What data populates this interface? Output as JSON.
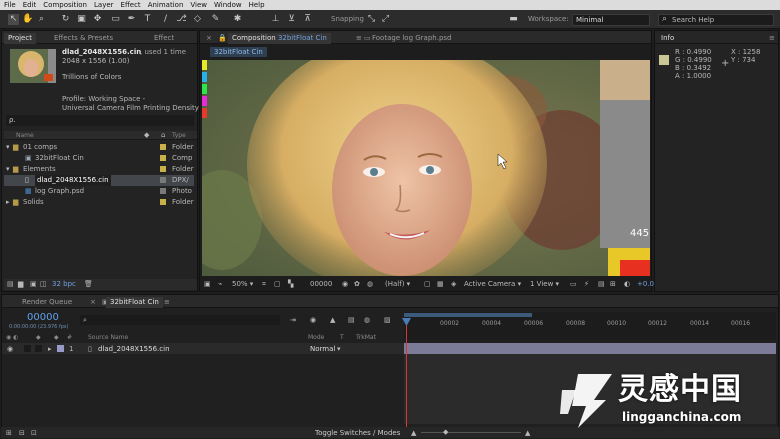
{
  "menu": [
    "File",
    "Edit",
    "Composition",
    "Layer",
    "Effect",
    "Animation",
    "View",
    "Window",
    "Help"
  ],
  "toolbar": {
    "snapping_label": "Snapping",
    "workspace_label": "Workspace:",
    "workspace_value": "Minimal",
    "search_placeholder": "Search Help"
  },
  "project": {
    "tabs": [
      "Project",
      "Effects & Presets",
      "Effect"
    ],
    "file_name": "dlad_2048X1556.cin",
    "used": ", used 1 time",
    "dimensions": "2048 x 1556 (1.00)",
    "colors": "Trillions of Colors",
    "profile_line1": "Profile: Working Space -",
    "profile_line2": "Universal Camera Film Printing Density (...",
    "search_icon_label": "ρ.",
    "col_name": "Name",
    "col_type": "Type",
    "items": [
      {
        "name": "01 comps",
        "type": "Folder",
        "color": "#c9b04a",
        "level": 0,
        "kind": "folder"
      },
      {
        "name": "32bitFloat Cin",
        "type": "Comp",
        "color": "#c9b04a",
        "level": 1,
        "kind": "comp"
      },
      {
        "name": "Elements",
        "type": "Folder",
        "color": "#c9b04a",
        "level": 0,
        "kind": "folder"
      },
      {
        "name": "dlad_2048X1556.cin",
        "type": "DPX/",
        "color": "#7a7a7a",
        "level": 1,
        "kind": "file"
      },
      {
        "name": "log Graph.psd",
        "type": "Photo",
        "color": "#7a7a7a",
        "level": 1,
        "kind": "psd"
      },
      {
        "name": "Solids",
        "type": "Folder",
        "color": "#c9b04a",
        "level": 0,
        "kind": "folder"
      }
    ],
    "bpc": "32 bpc"
  },
  "composition": {
    "tabs": [
      "Composition 32bitFloat Cin",
      "Footage log Graph.psd"
    ],
    "comp_tab_prefix": "Composition",
    "comp_tab_name": "32bitFloat Cin",
    "sub_tab": "32bitFloat Cin",
    "overlay_number": "445",
    "zoom": "50%",
    "timecode": "00000",
    "resolution": "(Half)",
    "camera": "Active Camera",
    "view": "1 View",
    "exposure": "+0.0"
  },
  "info": {
    "title": "Info",
    "r": "R : 0.4990",
    "g": "G : 0.4990",
    "b": "B : 0.3492",
    "a": "A : 1.0000",
    "x": "X : 1258",
    "y": "Y : 734",
    "swatch_color": "#c9c597"
  },
  "timeline": {
    "tabs": [
      "Render Queue",
      "32bitFloat Cin"
    ],
    "timecode": "00000",
    "timecode_sub": "0:00:00:00 (23.976 fps)",
    "col_hash": "#",
    "col_source": "Source Name",
    "col_mode": "Mode",
    "col_t": "T",
    "col_trkmat": "TrkMat",
    "layer_num": "1",
    "layer_name": "dlad_2048X1556.cin",
    "layer_mode": "Normal",
    "ruler": [
      "00002",
      "00004",
      "00006",
      "00008",
      "00010",
      "00012",
      "00014",
      "00016"
    ],
    "toggle_label": "Toggle Switches / Modes"
  },
  "watermark": {
    "cn": "灵感中国",
    "en": "lingganchina.com"
  }
}
